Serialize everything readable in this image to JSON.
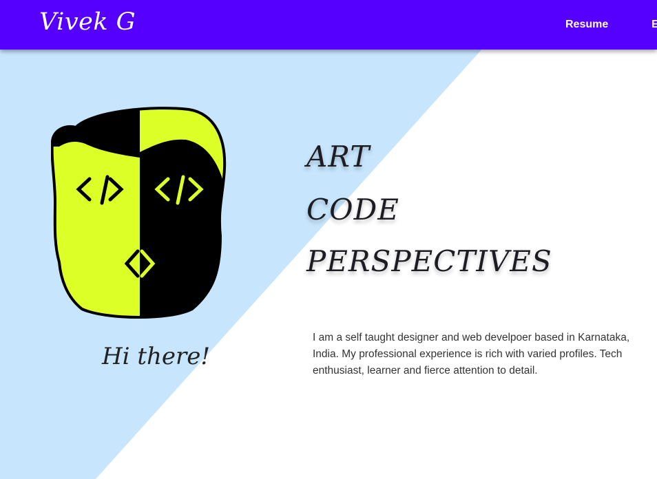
{
  "header": {
    "brand": "Vivek G",
    "nav": [
      "Resume",
      "E"
    ]
  },
  "hero": {
    "logo": {
      "icon": "code-face-icon",
      "left_code": "</>",
      "right_code": "</>",
      "colors": {
        "lime": "#dcff28",
        "black": "#000000"
      }
    },
    "greeting": "Hi there!",
    "tagline": [
      "ART",
      "CODE",
      "PERSPECTIVES"
    ],
    "about": "I am a self taught designer and web develpoer based in Karnataka, India. My professional experience is rich with varied profiles. Tech enthusiast, learner and fierce attention to detail."
  },
  "colors": {
    "nav_bg": "#5500ff",
    "diagonal_bg": "#c7e6fd",
    "text_dark": "#1c1c22"
  }
}
